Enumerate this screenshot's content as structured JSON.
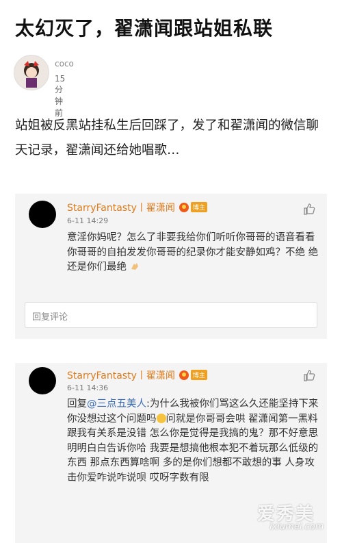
{
  "article": {
    "title": "太幻灭了，翟潇闻跟站姐私联",
    "author_name": "coco",
    "author_time": "15分钟前",
    "intro": "站姐被反黑站挂私生后回踩了，发了和翟潇闻的微信聊天记录，翟潇闻还给她唱歌…"
  },
  "comments": [
    {
      "username": "StarryFantasty丨翟潇闻",
      "badge": "博主",
      "date": "6-11 14:29",
      "text": "意淫你妈呢？怎么了非要我给你们听听你哥哥的语音看看你哥哥的自拍发发你哥哥的纪录你才能安静如鸡？不绝 绝还是你们最绝",
      "reply_placeholder": "回复评论"
    },
    {
      "username": "StarryFantasty丨翟潇闻",
      "badge": "博主",
      "date": "6-11 14:36",
      "reply_prefix": "回复",
      "mention": "@三点五美人",
      "text_a": ":为什么我被你们骂这么久还能坚持下来 你没想过这个问题吗",
      "text_b": "问就是你哥哥会哄 翟潇闻第一黑料跟我有关系是没错 怎么你是觉得是我搞的鬼？那不好意思 明明白白告诉你哈 我要是想搞他根本犯不着玩那么低级的东西 那点东西算啥啊 多的是你们想都不敢想的事 人身攻击你爱咋说咋说呗 哎呀字数有限"
    }
  ],
  "watermark": {
    "text": "爱秀美",
    "sub": "ixiumei.com"
  }
}
